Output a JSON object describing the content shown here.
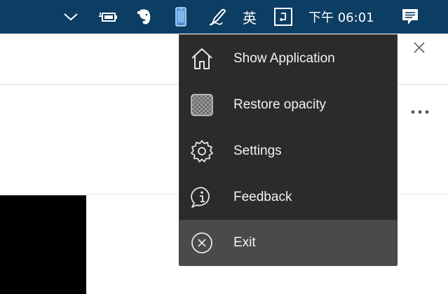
{
  "taskbar": {
    "background": "#0c3d63",
    "icons": [
      "chevron-up-icon",
      "battery-icon",
      "evernote-icon",
      "phone-icon",
      "pen-icon",
      "ime-icon",
      "keyboard-icon"
    ],
    "ime_label": "英",
    "clock": "下午 06:01",
    "notification_icon": "notification-icon"
  },
  "menu": {
    "background": "#2b2b2b",
    "hover_background": "#4a4a4a",
    "items": [
      {
        "label": "Show Application",
        "icon": "home-icon"
      },
      {
        "label": "Restore opacity",
        "icon": "opacity-icon"
      },
      {
        "label": "Settings",
        "icon": "gear-icon"
      },
      {
        "label": "Feedback",
        "icon": "feedback-icon"
      },
      {
        "label": "Exit",
        "icon": "exit-icon",
        "highlighted": true
      }
    ]
  }
}
